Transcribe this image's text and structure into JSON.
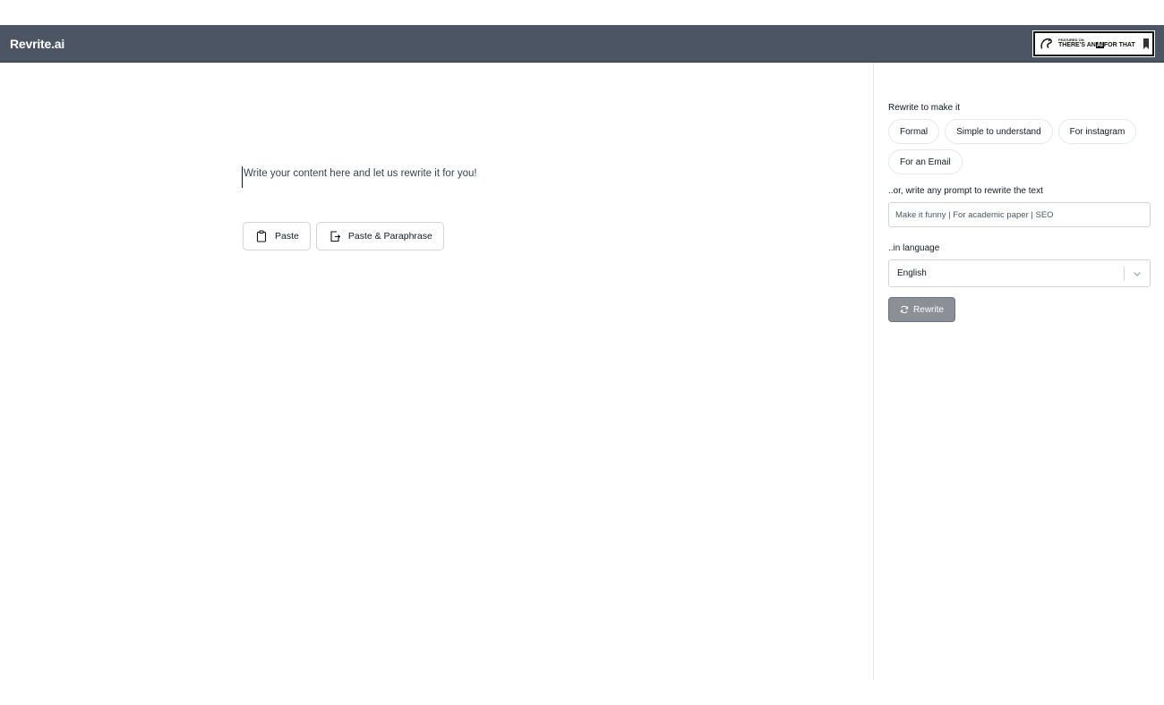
{
  "header": {
    "logo": "Revrite.ai",
    "badge": {
      "small_text": "FEATURED ON",
      "main_prefix": "THERE'S AN",
      "main_ai": "AI",
      "main_suffix": "FOR THAT"
    }
  },
  "editor": {
    "placeholder": "Write your content here and let us rewrite it for you!"
  },
  "actions": {
    "paste_label": "Paste",
    "paste_paraphrase_label": "Paste & Paraphrase"
  },
  "sidebar": {
    "rewrite_label": "Rewrite to make it",
    "chips": [
      "Formal",
      "Simple to understand",
      "For instagram",
      "For an Email"
    ],
    "prompt_label": "..or, write any prompt to rewrite the text",
    "prompt_placeholder": "Make it funny | For academic paper | SEO",
    "language_label": "..in language",
    "language_value": "English",
    "rewrite_button": "Rewrite"
  },
  "colors": {
    "header_bg": "#4b5563",
    "rewrite_button_bg": "#8b9097"
  }
}
